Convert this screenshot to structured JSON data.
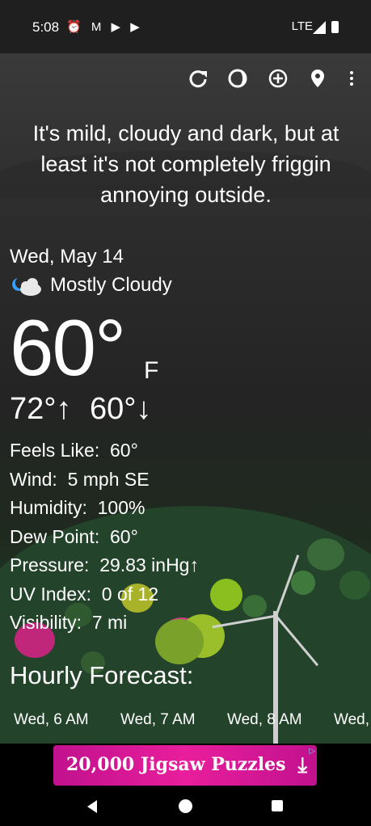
{
  "status_bar": {
    "time": "5:08",
    "icons": "⏰ M ▶ ▶",
    "network": "LTE"
  },
  "toolbar": {
    "icons": [
      "refresh-icon",
      "theme-icon",
      "add-location-icon",
      "location-pin-icon",
      "more-icon"
    ]
  },
  "headline": "It's mild, cloudy and dark, but at least it's not completely friggin annoying outside.",
  "current": {
    "date": "Wed, May 14",
    "condition": "Mostly Cloudy",
    "temperature": "60°",
    "unit": "F",
    "high": "72°↑",
    "low": "60°↓"
  },
  "details": [
    {
      "label": "Feels Like:",
      "value": "60°"
    },
    {
      "label": "Wind:",
      "value": "5 mph SE"
    },
    {
      "label": "Humidity:",
      "value": "100%"
    },
    {
      "label": "Dew Point:",
      "value": "60°"
    },
    {
      "label": "Pressure:",
      "value": "29.83 inHg↑"
    },
    {
      "label": "UV Index:",
      "value": "0 of 12"
    },
    {
      "label": "Visibility:",
      "value": "7 mi"
    }
  ],
  "hourly": {
    "title": "Hourly Forecast:",
    "hours": [
      "Wed, 6 AM",
      "Wed, 7 AM",
      "Wed, 8 AM",
      "Wed,"
    ]
  },
  "ad": {
    "text": "20,000 Jigsaw Puzzles",
    "colors": {
      "background": "#e91e9c"
    }
  }
}
